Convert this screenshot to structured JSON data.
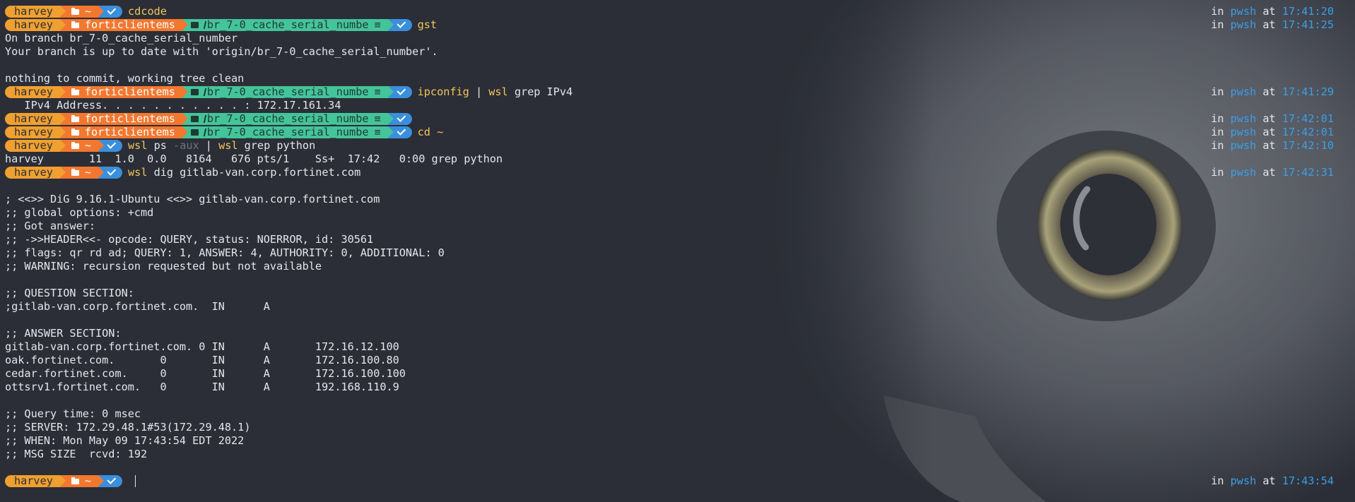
{
  "prompt": {
    "user": "harvey",
    "home": "~",
    "repo_dir": "forticlientems",
    "branch": "br_7-0_cache_serial_numbe",
    "branch_status": "≡"
  },
  "rprompt": {
    "in_label": "in",
    "shell": "pwsh",
    "at_label": "at"
  },
  "entries": [
    {
      "times": "17:41:20",
      "cmd": "cdcode"
    },
    {
      "times": "17:41:25",
      "cmd": "gst"
    },
    {
      "times": "17:41:29",
      "cmd_parts": [
        "ipconfig",
        " | ",
        "wsl",
        " grep IPv4"
      ]
    },
    {
      "times": "17:42:01"
    },
    {
      "times": "17:42:01",
      "cmd": "cd ~"
    },
    {
      "times": "17:42:10",
      "cmd_parts": [
        "wsl",
        " ps ",
        "-aux",
        " | ",
        "wsl",
        " grep python"
      ]
    },
    {
      "times": "17:42:31",
      "cmd_parts": [
        "wsl",
        " dig gitlab-van.corp.fortinet.com"
      ]
    },
    {
      "times": "17:43:54"
    }
  ],
  "output": {
    "gst": [
      "On branch br_7-0_cache_serial_number",
      "Your branch is up to date with 'origin/br_7-0_cache_serial_number'.",
      "",
      "nothing to commit, working tree clean"
    ],
    "ipconfig": [
      "   IPv4 Address. . . . . . . . . . . : 172.17.161.34"
    ],
    "ps": [
      "harvey       11  1.0  0.0   8164   676 pts/1    Ss+  17:42   0:00 grep python"
    ],
    "dig": [
      "",
      "; <<>> DiG 9.16.1-Ubuntu <<>> gitlab-van.corp.fortinet.com",
      ";; global options: +cmd",
      ";; Got answer:",
      ";; ->>HEADER<<- opcode: QUERY, status: NOERROR, id: 30561",
      ";; flags: qr rd ad; QUERY: 1, ANSWER: 4, AUTHORITY: 0, ADDITIONAL: 0",
      ";; WARNING: recursion requested but not available",
      "",
      ";; QUESTION SECTION:",
      ";gitlab-van.corp.fortinet.com.  IN      A",
      "",
      ";; ANSWER SECTION:",
      "gitlab-van.corp.fortinet.com. 0 IN      A       172.16.12.100",
      "oak.fortinet.com.       0       IN      A       172.16.100.80",
      "cedar.fortinet.com.     0       IN      A       172.16.100.100",
      "ottsrv1.fortinet.com.   0       IN      A       192.168.110.9",
      "",
      ";; Query time: 0 msec",
      ";; SERVER: 172.29.48.1#53(172.29.48.1)",
      ";; WHEN: Mon May 09 17:43:54 EDT 2022",
      ";; MSG SIZE  rcvd: 192",
      ""
    ]
  },
  "colors": {
    "background": "#2b2e36",
    "user_segment": "#f0a030",
    "path_segment": "#f27830",
    "git_segment": "#44c49a",
    "status_segment": "#3a8fdc",
    "command_yellow": "#f2c55c",
    "shell_blue": "#3a9ee8"
  }
}
